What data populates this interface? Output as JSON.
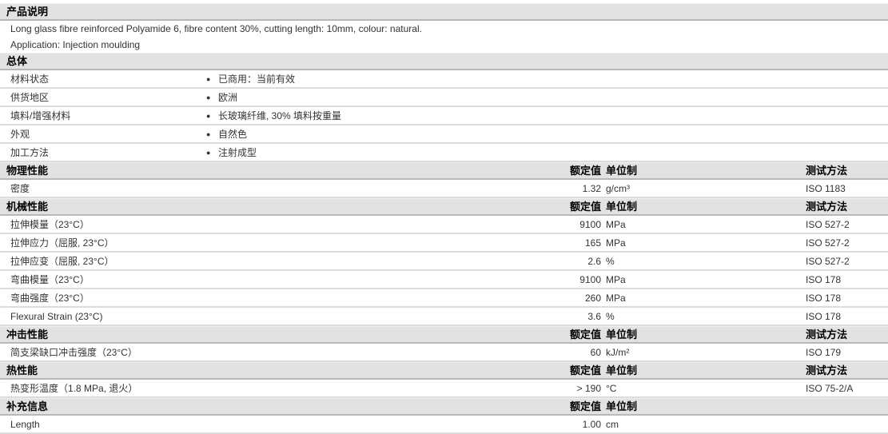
{
  "description": {
    "title": "产品说明",
    "lines": [
      "Long glass fibre reinforced Polyamide 6, fibre content 30%, cutting length: 10mm, colour: natural.",
      "Application: Injection moulding"
    ]
  },
  "general": {
    "title": "总体",
    "rows": [
      {
        "label": "材料状态",
        "value": "已商用：当前有效"
      },
      {
        "label": "供货地区",
        "value": "欧洲"
      },
      {
        "label": "填料/增强材料",
        "value": "长玻璃纤维, 30% 填料按重量"
      },
      {
        "label": "外观",
        "value": "自然色"
      },
      {
        "label": "加工方法",
        "value": "注射成型"
      }
    ]
  },
  "col_headers": {
    "value": "额定值",
    "unit": "单位制",
    "method": "测试方法"
  },
  "sections": [
    {
      "title": "物理性能",
      "has_method": true,
      "rows": [
        {
          "label": "密度",
          "value": "1.32",
          "unit": "g/cm³",
          "method": "ISO 1183"
        }
      ]
    },
    {
      "title": "机械性能",
      "has_method": true,
      "rows": [
        {
          "label": "拉伸模量（23°C）",
          "value": "9100",
          "unit": "MPa",
          "method": "ISO 527-2"
        },
        {
          "label": "拉伸应力（屈服, 23°C）",
          "value": "165",
          "unit": "MPa",
          "method": "ISO 527-2"
        },
        {
          "label": "拉伸应变（屈服, 23°C）",
          "value": "2.6",
          "unit": "%",
          "method": "ISO 527-2"
        },
        {
          "label": "弯曲模量（23°C）",
          "value": "9100",
          "unit": "MPa",
          "method": "ISO 178"
        },
        {
          "label": "弯曲强度（23°C）",
          "value": "260",
          "unit": "MPa",
          "method": "ISO 178"
        },
        {
          "label": "Flexural Strain (23°C)",
          "value": "3.6",
          "unit": "%",
          "method": "ISO 178"
        }
      ]
    },
    {
      "title": "冲击性能",
      "has_method": true,
      "rows": [
        {
          "label": "简支梁缺口冲击强度（23°C）",
          "value": "60",
          "unit": "kJ/m²",
          "method": "ISO 179"
        }
      ]
    },
    {
      "title": "热性能",
      "has_method": true,
      "rows": [
        {
          "label": "热变形温度（1.8 MPa, 退火）",
          "value": "> 190",
          "unit": "°C",
          "method": "ISO 75-2/A"
        }
      ]
    },
    {
      "title": "补充信息",
      "has_method": false,
      "rows": [
        {
          "label": "Length",
          "value": "1.00",
          "unit": "cm",
          "method": ""
        }
      ]
    }
  ]
}
